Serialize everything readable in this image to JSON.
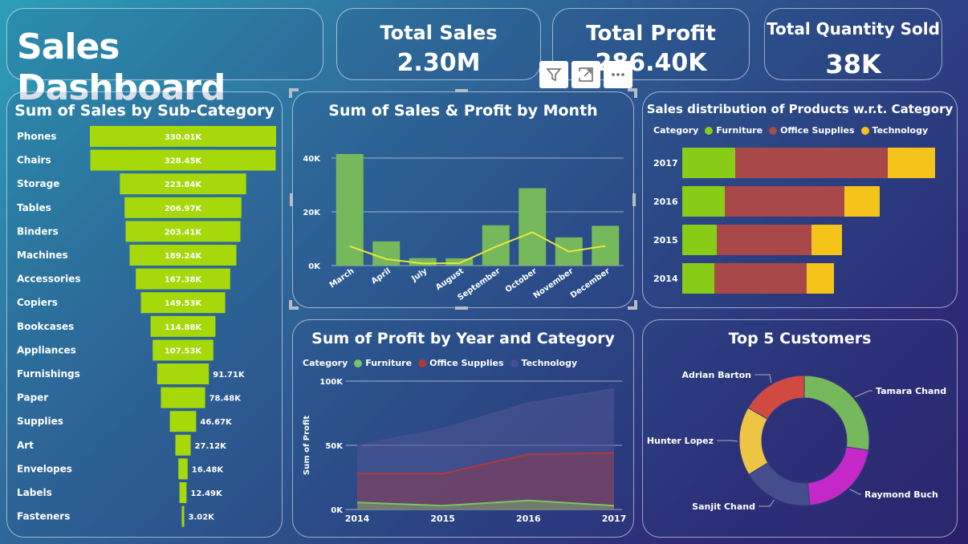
{
  "header": {
    "title": "Sales Dashboard"
  },
  "kpis": [
    {
      "label": "Total Sales",
      "value": "2.30M"
    },
    {
      "label": "Total Profit",
      "value": "286.40K"
    },
    {
      "label": "Total Quantity Sold",
      "value": "38K"
    }
  ],
  "toolbar": {
    "icons": [
      "filter-icon",
      "expand-icon",
      "more-options-icon"
    ]
  },
  "colors": {
    "lime": "#a6d80a",
    "bars": "#76b85c",
    "line": "#e8e83a",
    "furniture": "#88cc18",
    "office": "#a84848",
    "technology": "#f4c41a"
  },
  "chart_data": [
    {
      "id": "subcat",
      "type": "bar",
      "title": "Sum of Sales by Sub-Category",
      "categories": [
        "Phones",
        "Chairs",
        "Storage",
        "Tables",
        "Binders",
        "Machines",
        "Accessories",
        "Copiers",
        "Bookcases",
        "Appliances",
        "Furnishings",
        "Paper",
        "Supplies",
        "Art",
        "Envelopes",
        "Labels",
        "Fasteners"
      ],
      "values": [
        330.01,
        328.45,
        223.84,
        206.97,
        203.41,
        189.24,
        167.38,
        149.53,
        114.88,
        107.53,
        91.71,
        78.48,
        46.67,
        27.12,
        16.48,
        12.49,
        3.02
      ],
      "labels": [
        "330.01K",
        "328.45K",
        "223.84K",
        "206.97K",
        "203.41K",
        "189.24K",
        "167.38K",
        "149.53K",
        "114.88K",
        "107.53K",
        "91.71K",
        "78.48K",
        "46.67K",
        "27.12K",
        "16.48K",
        "12.49K",
        "3.02K"
      ]
    },
    {
      "id": "month",
      "type": "bar",
      "title": "Sum of Sales & Profit by Month",
      "categories": [
        "March",
        "April",
        "July",
        "August",
        "September",
        "October",
        "November",
        "December"
      ],
      "yticks": [
        "0K",
        "20K",
        "40K"
      ],
      "ylim": [
        0,
        45000
      ],
      "series": [
        {
          "values": [
            41500,
            9000,
            2800,
            2700,
            15000,
            28800,
            10500,
            14800
          ]
        },
        {
          "values": [
            7200,
            2400,
            800,
            900,
            7000,
            12400,
            5200,
            7300
          ]
        }
      ]
    },
    {
      "id": "category",
      "type": "bar",
      "title": "Sales distribution of Products w.r.t. Category",
      "legend_title": "Category",
      "categories": [
        "2017",
        "2016",
        "2015",
        "2014"
      ],
      "series": [
        {
          "name": "Furniture",
          "values": [
            66,
            53,
            43,
            40
          ]
        },
        {
          "name": "Office Supplies",
          "values": [
            190,
            149,
            118,
            115
          ]
        },
        {
          "name": "Technology",
          "values": [
            59,
            44,
            38,
            34
          ]
        }
      ]
    },
    {
      "id": "profit",
      "type": "area",
      "title": "Sum of Profit by Year and Category",
      "legend_title": "Category",
      "ylabel": "Sum of Profit",
      "x": [
        "2014",
        "2015",
        "2016",
        "2017"
      ],
      "yticks": [
        "0K",
        "50K",
        "100K"
      ],
      "ylim": [
        0,
        100000
      ],
      "series": [
        {
          "name": "Furniture",
          "values": [
            5500,
            3000,
            7000,
            3000
          ]
        },
        {
          "name": "Office Supplies",
          "values": [
            28000,
            28000,
            43000,
            44000
          ]
        },
        {
          "name": "Technology",
          "values": [
            50000,
            63000,
            83000,
            94000
          ]
        }
      ]
    },
    {
      "id": "customers",
      "type": "pie",
      "title": "Top 5 Customers",
      "labels": [
        "Tamara Chand",
        "Raymond Buch",
        "Sanjit Chand",
        "Hunter Lopez",
        "Adrian Barton"
      ],
      "values": [
        8981,
        6976,
        5757,
        5622,
        5444
      ]
    }
  ]
}
